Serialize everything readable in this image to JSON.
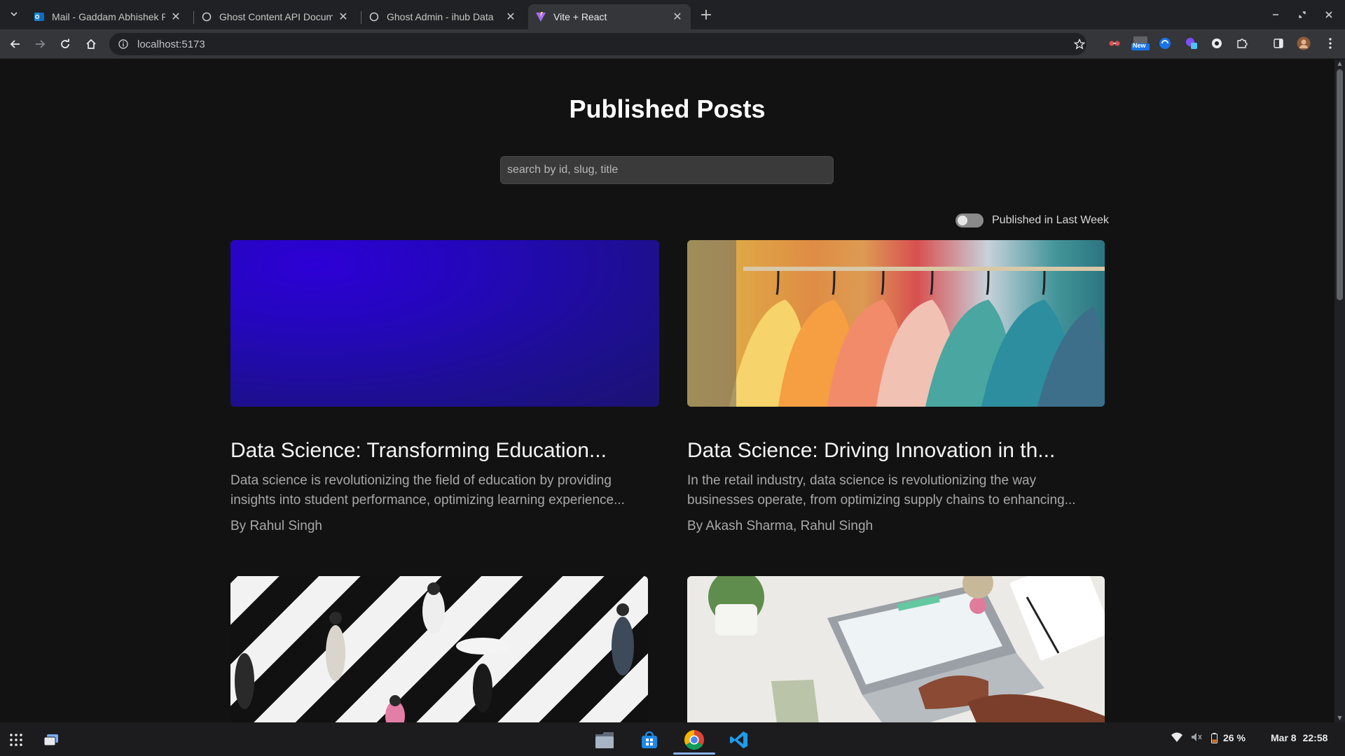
{
  "browser": {
    "tabs": [
      {
        "title": "Mail - Gaddam Abhishek R",
        "favicon": "outlook-icon",
        "active": false
      },
      {
        "title": "Ghost Content API Docum",
        "favicon": "ghost-icon",
        "active": false
      },
      {
        "title": "Ghost Admin - ihub Data",
        "favicon": "ghost-icon",
        "active": false
      },
      {
        "title": "Vite + React",
        "favicon": "vite-icon",
        "active": true
      }
    ],
    "url": "localhost:5173",
    "new_badge": "New"
  },
  "page": {
    "title": "Published Posts",
    "search_placeholder": "search by id, slug, title",
    "toggle_label": "Published in Last Week",
    "toggle_on": false
  },
  "posts": [
    {
      "title": "Data Science: Transforming Education...",
      "excerpt": "Data science is revolutionizing the field of education by providing insights into student performance, optimizing learning experience...",
      "author": "By Rahul Singh",
      "image": "purple-gradient"
    },
    {
      "title": "Data Science: Driving Innovation in th...",
      "excerpt": "In the retail industry, data science is revolutionizing the way businesses operate, from optimizing supply chains to enhancing...",
      "author": "By Akash Sharma, Rahul Singh",
      "image": "clothing-rack-photo"
    },
    {
      "title": "",
      "excerpt": "",
      "author": "",
      "image": "crosswalk-photo"
    },
    {
      "title": "",
      "excerpt": "",
      "author": "",
      "image": "laptop-desk-photo"
    }
  ],
  "taskbar": {
    "battery": "26 %",
    "date": "Mar 8",
    "time": "22:58"
  },
  "colors": {
    "page_bg": "#121212",
    "chrome_dark": "#202124",
    "toolbar": "#35363a",
    "accent_blue": "#8ab4f8"
  }
}
